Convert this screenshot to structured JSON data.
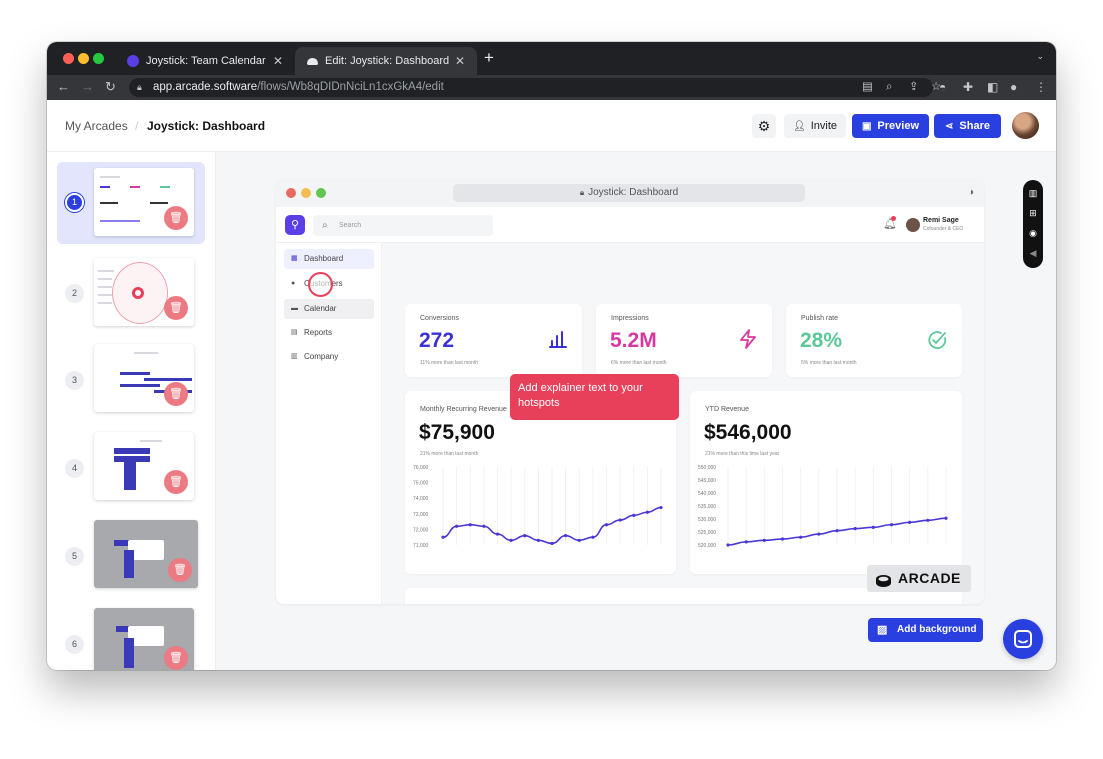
{
  "browser": {
    "tabs": [
      {
        "label": "Joystick: Team Calendar",
        "active": false
      },
      {
        "label": "Edit: Joystick: Dashboard",
        "active": true
      }
    ],
    "new_tab_icon": "plus-icon",
    "url_host": "app.arcade.software",
    "url_path": "/flows/Wb8qDIDnNciLn1cxGkA4/edit"
  },
  "header": {
    "breadcrumb_root": "My Arcades",
    "breadcrumb_current": "Joystick: Dashboard",
    "invite_label": "Invite",
    "preview_label": "Preview",
    "share_label": "Share"
  },
  "steps": [
    {
      "number": "1",
      "selected": true
    },
    {
      "number": "2",
      "selected": false
    },
    {
      "number": "3",
      "selected": false
    },
    {
      "number": "4",
      "selected": false
    },
    {
      "number": "5",
      "selected": false
    },
    {
      "number": "6",
      "selected": false
    }
  ],
  "inner_app": {
    "window_title": "Joystick: Dashboard",
    "search_placeholder": "Search",
    "user_name": "Remi Sage",
    "user_role": "Cofounder & CEO",
    "nav": [
      "Dashboard",
      "Customers",
      "Calendar",
      "Reports",
      "Company"
    ],
    "kpis": [
      {
        "label": "Conversions",
        "value": "272",
        "sub": "11% more than last month",
        "color": "#3b2fd6",
        "icon": "bar-chart-icon"
      },
      {
        "label": "Impressions",
        "value": "5.2M",
        "sub": "6% more than last month",
        "color": "#d63aa0",
        "icon": "lightning-icon"
      },
      {
        "label": "Publish rate",
        "value": "28%",
        "sub": "5% more than last month",
        "color": "#5cc89a",
        "icon": "check-circle-icon"
      }
    ],
    "mrr": {
      "label": "Monthly Recurring Revenue",
      "value": "$75,900",
      "sub": "21% more than last month"
    },
    "ytd": {
      "label": "YTD Revenue",
      "value": "$546,000",
      "sub": "21% more than this time last year"
    }
  },
  "chart_data": [
    {
      "type": "line",
      "title": "Monthly Recurring Revenue",
      "y_ticks": [
        "76,000",
        "75,000",
        "74,000",
        "73,000",
        "72,000",
        "71,000"
      ],
      "ylim": [
        71000,
        76000
      ],
      "values": [
        71500,
        72200,
        72300,
        72200,
        71700,
        71300,
        71600,
        71300,
        71100,
        71600,
        71300,
        71500,
        72300,
        72600,
        72900,
        73100,
        73400
      ],
      "color": "#4a37d6"
    },
    {
      "type": "line",
      "title": "YTD Revenue",
      "y_ticks": [
        "550,000",
        "545,000",
        "540,000",
        "535,000",
        "530,000",
        "525,000",
        "520,000"
      ],
      "ylim": [
        520000,
        550000
      ],
      "values": [
        520000,
        521200,
        521800,
        522300,
        523000,
        524200,
        525500,
        526300,
        526800,
        527800,
        528700,
        529500,
        530300
      ],
      "color": "#4a37d6"
    }
  ],
  "tooltip": {
    "text": "Add explainer text to your hotspots"
  },
  "watermark": "ARCADE",
  "add_background_label": "Add background",
  "colors": {
    "primary": "#2a3fe0",
    "tooltip": "#e8405a"
  }
}
